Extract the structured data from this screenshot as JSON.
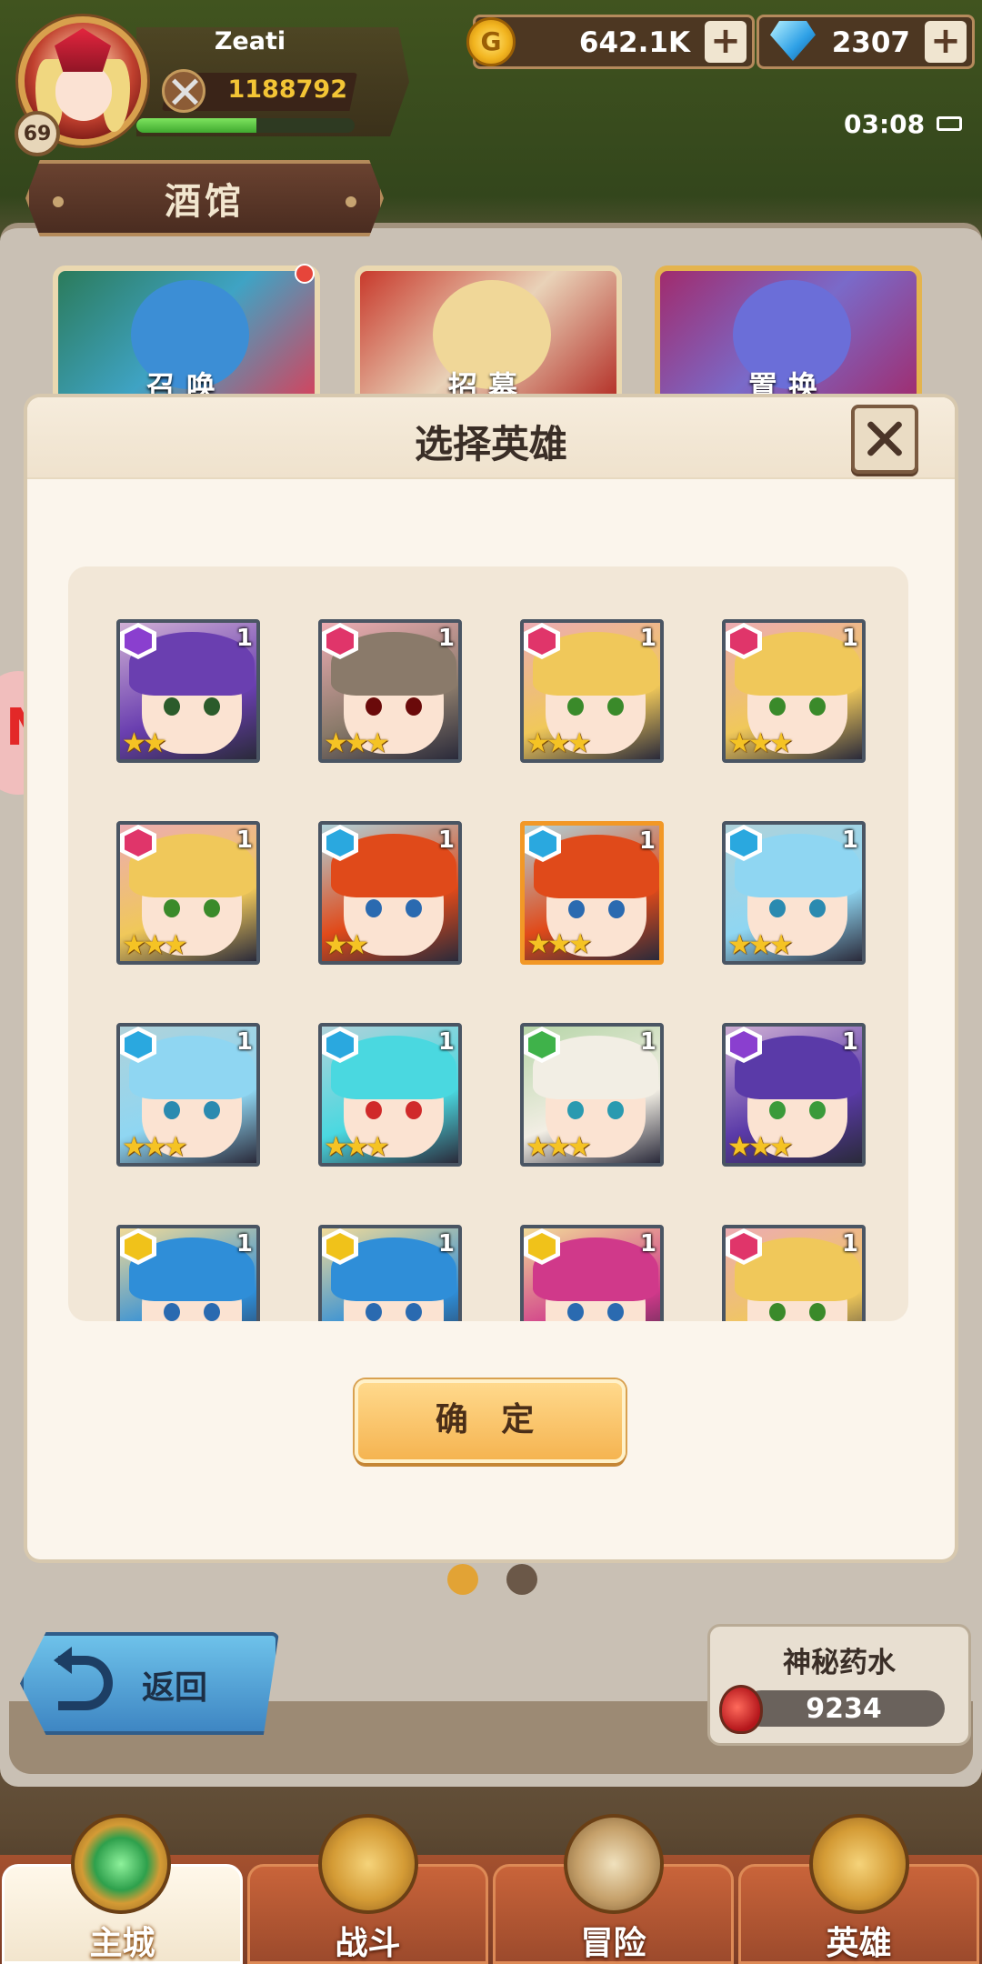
{
  "player": {
    "name": "Zeati",
    "level": "69",
    "power": "1188792",
    "xp_fraction": 0.55
  },
  "currency": {
    "gold": "642.1K",
    "gems": "2307",
    "plus": "+"
  },
  "status": {
    "time": "03:08"
  },
  "screen": {
    "title": "酒馆"
  },
  "tavern_cards": [
    {
      "label": "召唤"
    },
    {
      "label": "招募"
    },
    {
      "label": "置换"
    }
  ],
  "modal": {
    "title": "选择英雄",
    "confirm_label": "确 定",
    "heroes": [
      {
        "faction": "dark",
        "stars": "★★",
        "count": "1",
        "hair": "#6a3fb0",
        "eyes": "#2b5b2b",
        "faction_color": "#8a3fcf"
      },
      {
        "faction": "fire",
        "stars": "★★★",
        "count": "1",
        "hair": "#8a7a6a",
        "eyes": "#6a0a0a",
        "faction_color": "#e0356a"
      },
      {
        "faction": "fire",
        "stars": "★★★",
        "count": "1",
        "hair": "#f0c85a",
        "eyes": "#3a8a2a",
        "faction_color": "#e0356a"
      },
      {
        "faction": "fire",
        "stars": "★★★",
        "count": "1",
        "hair": "#f0c85a",
        "eyes": "#3a8a2a",
        "faction_color": "#e0356a"
      },
      {
        "faction": "fire",
        "stars": "★★★",
        "count": "1",
        "hair": "#f0c85a",
        "eyes": "#3a8a2a",
        "faction_color": "#e0356a"
      },
      {
        "faction": "water",
        "stars": "★★",
        "count": "1",
        "hair": "#e04a1a",
        "eyes": "#2a6ab0",
        "faction_color": "#2aa8df"
      },
      {
        "faction": "water",
        "stars": "★★★",
        "count": "1",
        "hair": "#e04a1a",
        "eyes": "#2a6ab0",
        "faction_color": "#2aa8df",
        "selected": true
      },
      {
        "faction": "water",
        "stars": "★★★",
        "count": "1",
        "hair": "#8fd6f2",
        "eyes": "#2a8ab0",
        "faction_color": "#2aa8df"
      },
      {
        "faction": "water",
        "stars": "★★★",
        "count": "1",
        "hair": "#8fd6f2",
        "eyes": "#2a8ab0",
        "faction_color": "#2aa8df"
      },
      {
        "faction": "water",
        "stars": "★★★",
        "count": "1",
        "hair": "#4ad8e0",
        "eyes": "#d02a2a",
        "faction_color": "#2aa8df"
      },
      {
        "faction": "nature",
        "stars": "★★★",
        "count": "1",
        "hair": "#f2eee4",
        "eyes": "#2a9ab0",
        "faction_color": "#3fb24a"
      },
      {
        "faction": "dark",
        "stars": "★★★",
        "count": "1",
        "hair": "#5a3aa8",
        "eyes": "#3a9a3a",
        "faction_color": "#8a3fcf"
      },
      {
        "faction": "light",
        "stars": "",
        "count": "1",
        "hair": "#2f8ed8",
        "eyes": "#2a6ab0",
        "faction_color": "#f0c21a"
      },
      {
        "faction": "light",
        "stars": "",
        "count": "1",
        "hair": "#2f8ed8",
        "eyes": "#2a6ab0",
        "faction_color": "#f0c21a"
      },
      {
        "faction": "light",
        "stars": "",
        "count": "1",
        "hair": "#d0398a",
        "eyes": "#2a6ab0",
        "faction_color": "#f0c21a"
      },
      {
        "faction": "fire",
        "stars": "",
        "count": "1",
        "hair": "#f0c85a",
        "eyes": "#3a8a2a",
        "faction_color": "#e0356a"
      }
    ]
  },
  "back": {
    "label": "返回"
  },
  "potion": {
    "title": "神秘药水",
    "value": "9234"
  },
  "nav": {
    "city": "主城",
    "battle": "战斗",
    "adventure": "冒险",
    "hero": "英雄"
  },
  "colors": {
    "selected_border": "#f29826",
    "confirm": "#f5b451",
    "back": "#3e86c3"
  }
}
